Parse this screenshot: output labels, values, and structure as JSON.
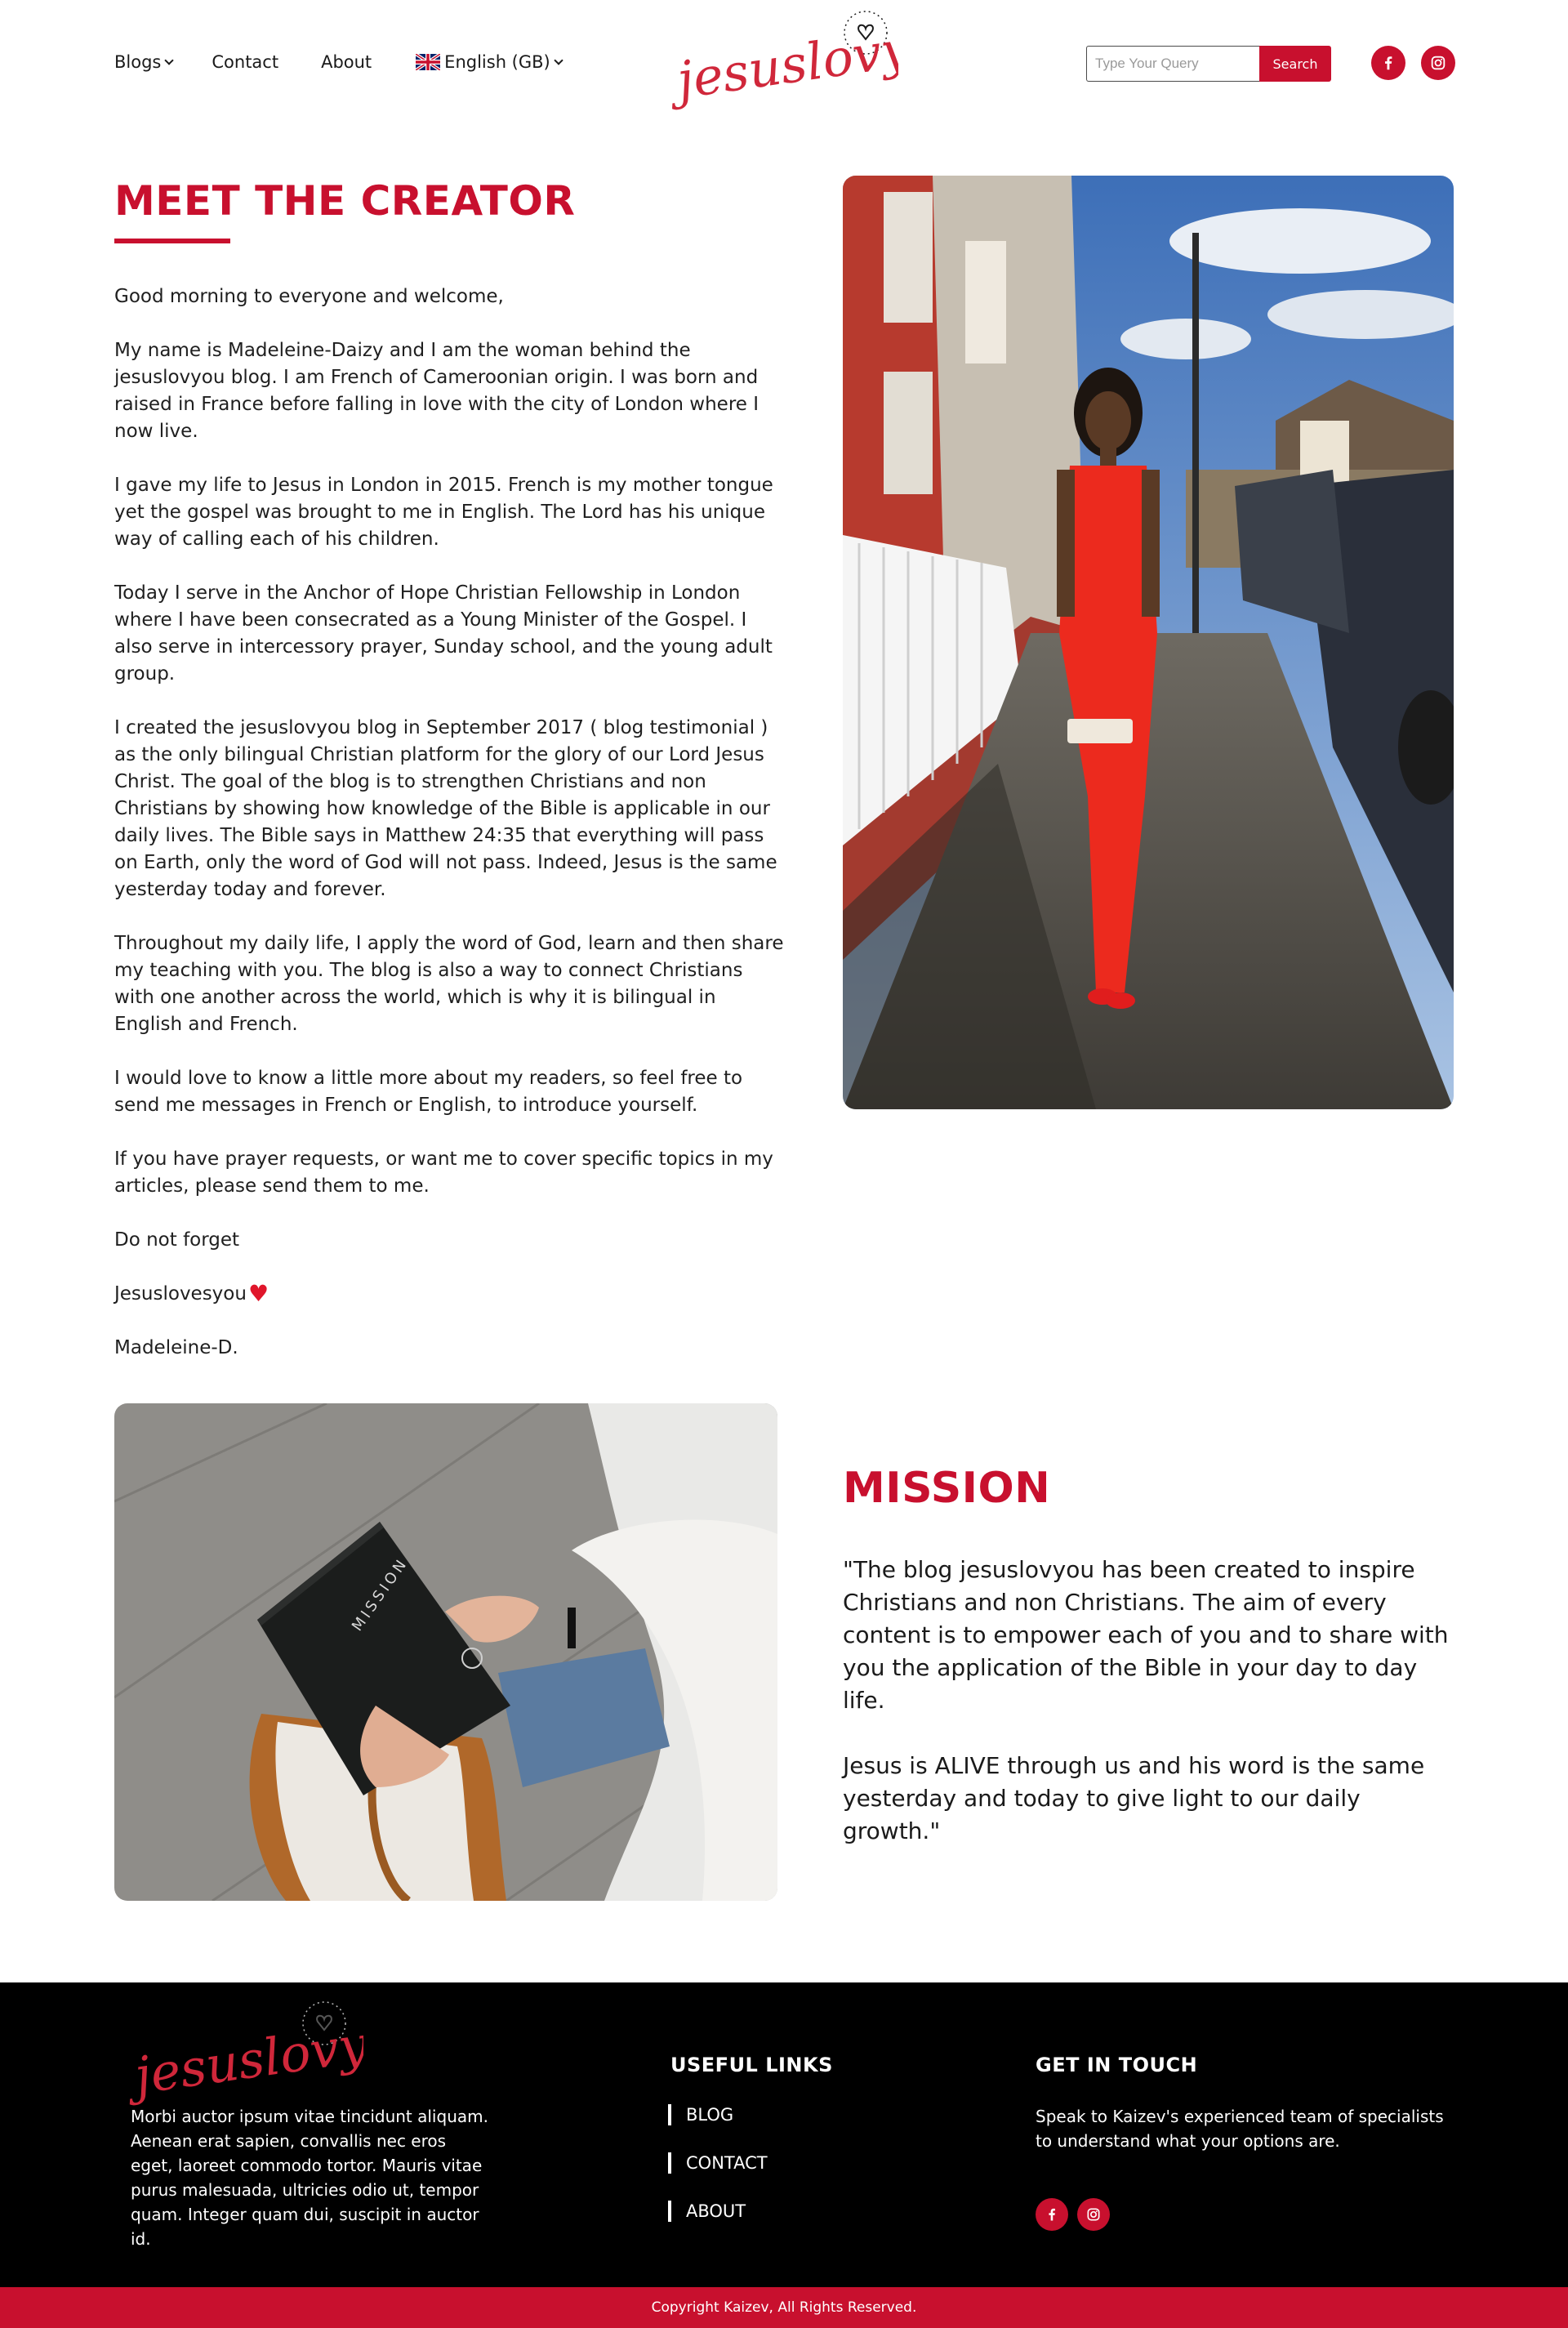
{
  "nav": {
    "blogs": "Blogs",
    "contact": "Contact",
    "about": "About",
    "language": "English (GB)"
  },
  "logo_text": "jesuslovyou",
  "search": {
    "placeholder": "Type Your Query",
    "button": "Search"
  },
  "icons": {
    "facebook": "facebook-icon",
    "instagram": "instagram-icon",
    "flag": "uk-flag-icon",
    "heart": "heart-icon"
  },
  "colors": {
    "brand": "#c8102e",
    "footer_bg": "#000000",
    "text": "#1a1a1a"
  },
  "creator": {
    "title": "MEET THE CREATOR",
    "paragraphs": [
      "Good morning to everyone and welcome,",
      "My name is Madeleine-Daizy and I am the woman behind the jesuslovyou blog. I am French of Cameroonian origin. I was born and raised in France before falling in love with the city of London where I now live.",
      "I gave my life to Jesus in London in 2015. French is my mother tongue yet the gospel was brought to me in English. The Lord has his unique way of calling each of his children.",
      "Today I serve in the Anchor of Hope Christian Fellowship in London where I have been consecrated as a Young Minister of the Gospel. I also serve in intercessory prayer, Sunday school, and the young adult group.",
      "I created the jesuslovyou blog in September 2017 ( blog testimonial ) as the only bilingual Christian platform for the glory of our Lord Jesus Christ. The goal of the blog is to strengthen Christians and non Christians by showing how knowledge of the Bible is applicable in our daily lives. The Bible says in Matthew 24:35 that everything will pass on Earth, only the word of God will not pass. Indeed, Jesus is the same yesterday today and forever.",
      "Throughout my daily life, I apply the word of God, learn and then share my teaching with you. The blog is also a way to connect Christians with one another across the world, which is why it is bilingual in English and French.",
      "I would love to know a little more about my readers, so feel free to send me messages in French or English, to introduce yourself.",
      "If you have prayer requests, or want me to cover specific topics in my articles, please send them to me.",
      "Do not forget"
    ],
    "signoff": "Jesuslovesyou",
    "signature": "Madeleine-D."
  },
  "mission": {
    "title": "MISSION",
    "paragraphs": [
      "\"The blog jesuslovyou has been created to inspire Christians and non Christians. The aim of every content is to empower each of you and to share with you the application of the Bible in your day to day life.",
      "Jesus is ALIVE through us and his word is the same yesterday and today to give light to our daily growth.\""
    ],
    "journal_text": "MISSION"
  },
  "footer": {
    "about": "Morbi auctor ipsum vitae tincidunt aliquam. Aenean erat sapien, convallis nec eros eget, laoreet commodo tortor. Mauris vitae purus malesuada, ultricies odio ut, tempor quam. Integer quam dui, suscipit in auctor id.",
    "links_heading": "USEFUL LINKS",
    "links": [
      "BLOG",
      "CONTACT",
      "ABOUT"
    ],
    "touch_heading": "GET IN TOUCH",
    "touch_text": "Speak to Kaizev's experienced team of specialists to understand what your options are.",
    "copyright": "Copyright Kaizev, All Rights Reserved."
  }
}
